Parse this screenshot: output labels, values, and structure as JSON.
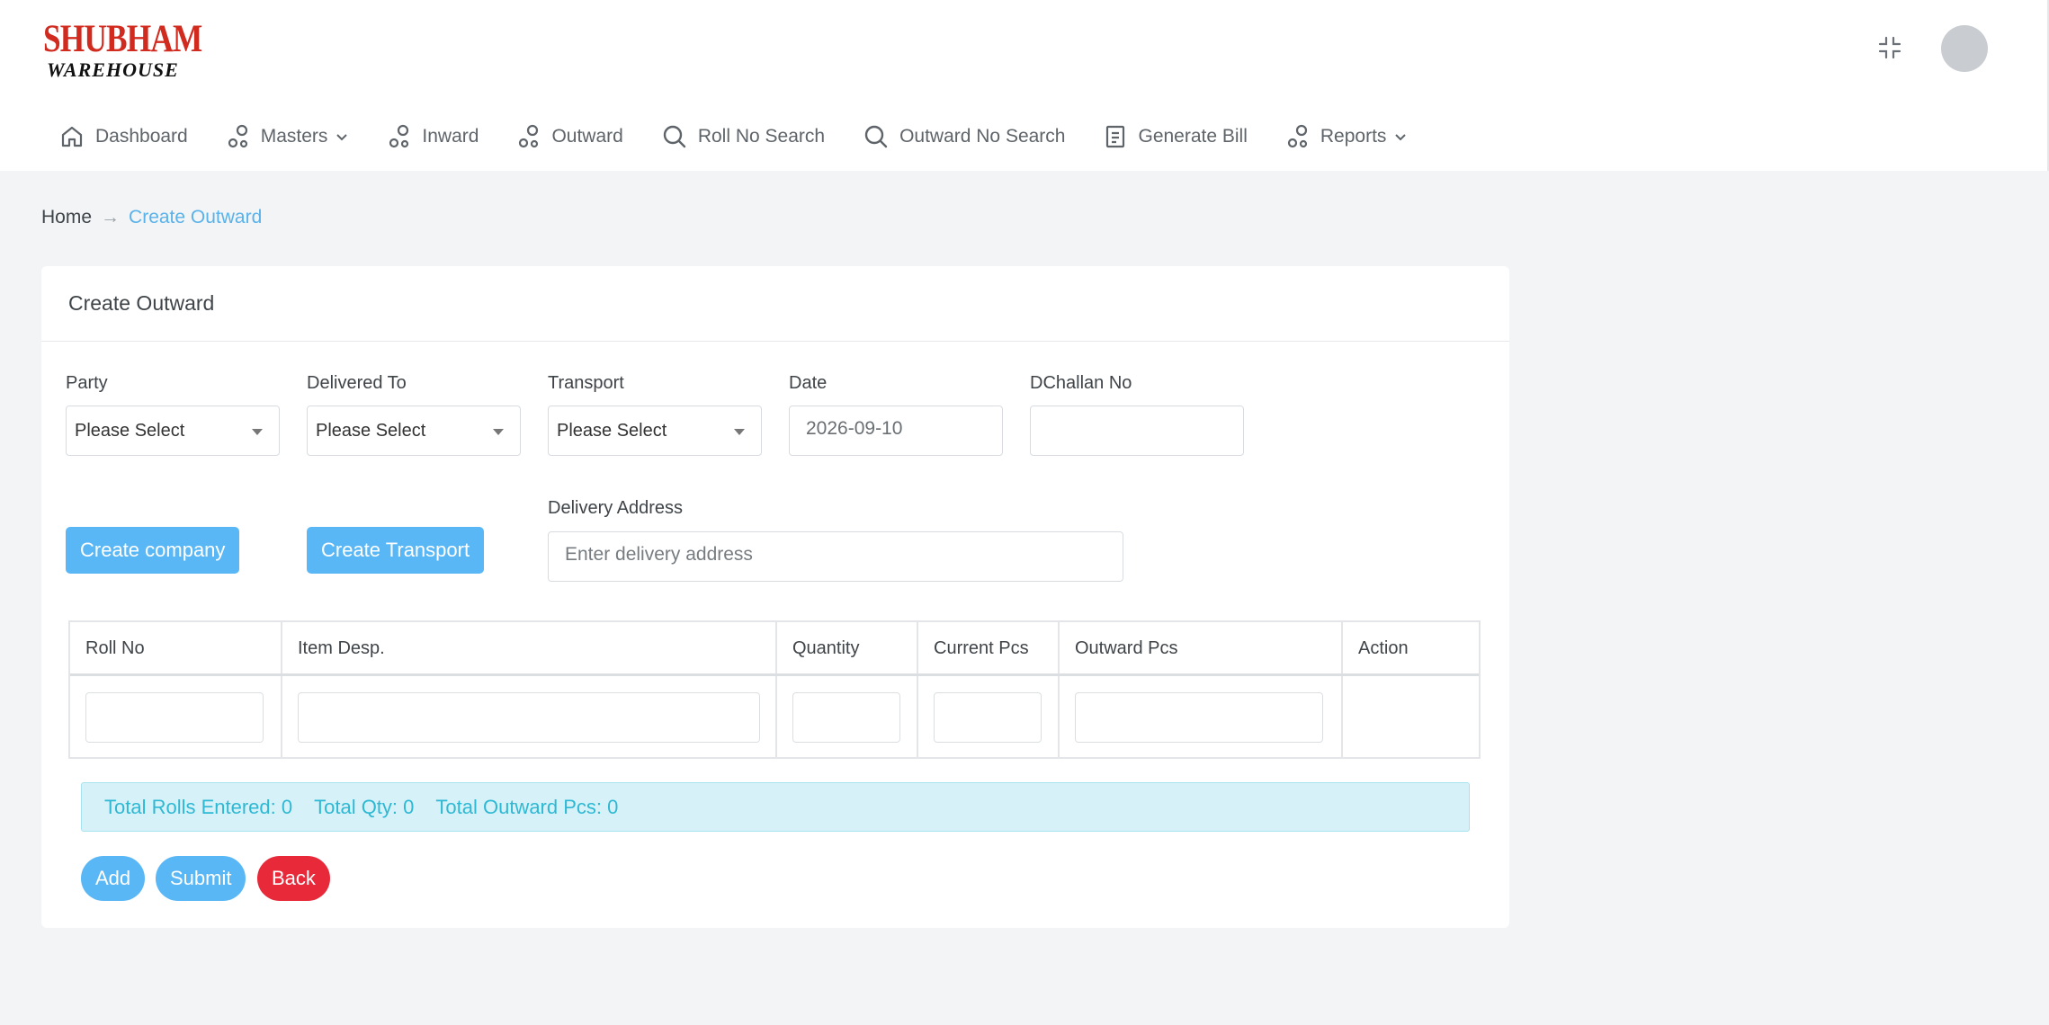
{
  "brand": {
    "line1": "SHUBHAM",
    "line2": "WAREHOUSE"
  },
  "nav": [
    {
      "label": "Dashboard",
      "icon": "home-icon",
      "dropdown": false
    },
    {
      "label": "Masters",
      "icon": "nodes-icon",
      "dropdown": true
    },
    {
      "label": "Inward",
      "icon": "nodes-icon",
      "dropdown": false
    },
    {
      "label": "Outward",
      "icon": "nodes-icon",
      "dropdown": false
    },
    {
      "label": "Roll No Search",
      "icon": "search-icon",
      "dropdown": false
    },
    {
      "label": "Outward No Search",
      "icon": "search-icon",
      "dropdown": false
    },
    {
      "label": "Generate Bill",
      "icon": "document-icon",
      "dropdown": false
    },
    {
      "label": "Reports",
      "icon": "nodes-icon",
      "dropdown": true
    }
  ],
  "breadcrumb": {
    "home": "Home",
    "separator": "→",
    "current": "Create Outward"
  },
  "card": {
    "title": "Create Outward"
  },
  "form": {
    "party": {
      "label": "Party",
      "value": "Please Select"
    },
    "delivered_to": {
      "label": "Delivered To",
      "value": "Please Select"
    },
    "transport": {
      "label": "Transport",
      "value": "Please Select"
    },
    "date": {
      "label": "Date",
      "value": "2026-09-10"
    },
    "dchallan": {
      "label": "DChallan No",
      "value": ""
    },
    "delivery_address": {
      "label": "Delivery Address",
      "placeholder": "Enter delivery address"
    },
    "create_company": "Create company",
    "create_transport": "Create Transport"
  },
  "table": {
    "headers": [
      "Roll No",
      "Item Desp.",
      "Quantity",
      "Current Pcs",
      "Outward Pcs",
      "Action"
    ]
  },
  "summary": {
    "rolls": "Total Rolls Entered: 0",
    "qty": "Total Qty: 0",
    "outward_pcs": "Total Outward Pcs: 0"
  },
  "actions": {
    "add": "Add",
    "submit": "Submit",
    "back": "Back"
  },
  "colors": {
    "primary": "#5ab7f5",
    "danger": "#e8293a",
    "info_bg": "#d6f2f8",
    "info_text": "#2fb8d4",
    "brand_red": "#d12b20"
  }
}
